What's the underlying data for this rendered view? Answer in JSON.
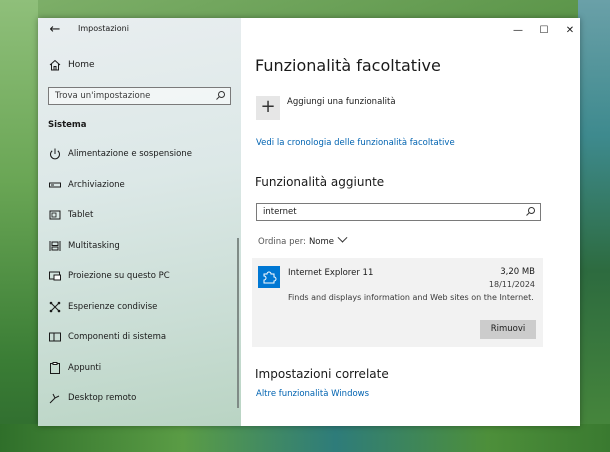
{
  "window": {
    "title": "Impostazioni",
    "controls": {
      "minimize": "—",
      "maximize": "☐",
      "close": "✕"
    }
  },
  "sidebar": {
    "home_label": "Home",
    "search_placeholder": "Trova un'impostazione",
    "section_title": "Sistema",
    "items": [
      {
        "label": "Alimentazione e sospensione",
        "icon": "power-icon"
      },
      {
        "label": "Archiviazione",
        "icon": "storage-icon"
      },
      {
        "label": "Tablet",
        "icon": "tablet-icon"
      },
      {
        "label": "Multitasking",
        "icon": "multitasking-icon"
      },
      {
        "label": "Proiezione su questo PC",
        "icon": "projection-icon"
      },
      {
        "label": "Esperienze condivise",
        "icon": "shared-experiences-icon"
      },
      {
        "label": "Componenti di sistema",
        "icon": "system-components-icon"
      },
      {
        "label": "Appunti",
        "icon": "clipboard-icon"
      },
      {
        "label": "Desktop remoto",
        "icon": "remote-desktop-icon"
      }
    ]
  },
  "main": {
    "title": "Funzionalità facoltative",
    "add_label": "Aggiungi una funzionalità",
    "history_link": "Vedi la cronologia delle funzionalità facoltative",
    "installed_title": "Funzionalità aggiunte",
    "filter_value": "internet",
    "sort_label": "Ordina per:",
    "sort_value": "Nome",
    "feature": {
      "name": "Internet Explorer 11",
      "size": "3,20 MB",
      "date": "18/11/2024",
      "description": "Finds and displays information and Web sites on the Internet.",
      "remove_label": "Rimuovi"
    },
    "related_title": "Impostazioni correlate",
    "related_link": "Altre funzionalità Windows"
  },
  "colors": {
    "accent": "#0078d4",
    "link": "#0063b1",
    "button": "#cccccc"
  }
}
